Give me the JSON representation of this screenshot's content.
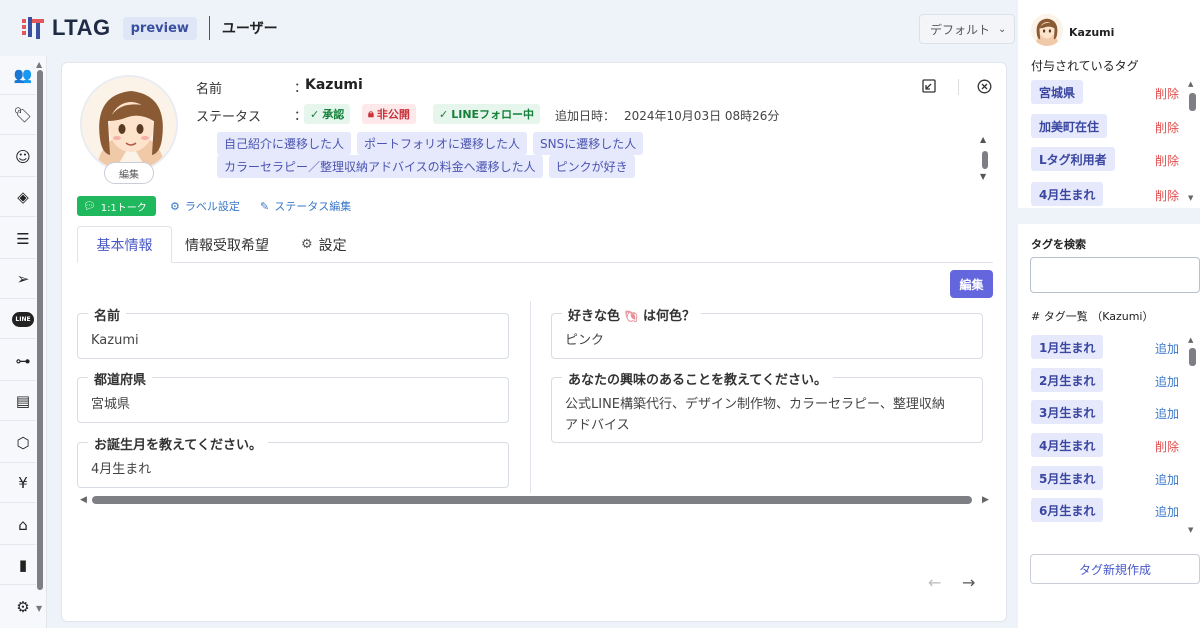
{
  "header": {
    "logo_text": "LTAG",
    "preview_badge": "preview",
    "page_title": "ユーザー",
    "view_select": "デフォルト"
  },
  "sidebar": {
    "items": [
      {
        "icon": "users-icon",
        "glyph": "👥"
      },
      {
        "icon": "tag-icon",
        "glyph": "🏷"
      },
      {
        "icon": "smile-icon",
        "glyph": "☺"
      },
      {
        "icon": "diamond-tag-icon",
        "glyph": "◈"
      },
      {
        "icon": "list-icon",
        "glyph": "☰"
      },
      {
        "icon": "send-icon",
        "glyph": "➢"
      },
      {
        "icon": "line-icon",
        "glyph": "LINE"
      },
      {
        "icon": "hierarchy-icon",
        "glyph": "⊶"
      },
      {
        "icon": "document-icon",
        "glyph": "▤"
      },
      {
        "icon": "box-icon",
        "glyph": "⬡"
      },
      {
        "icon": "yen-icon",
        "glyph": "¥"
      },
      {
        "icon": "shop-icon",
        "glyph": "⌂"
      },
      {
        "icon": "chart-icon",
        "glyph": "▮"
      },
      {
        "icon": "gear-icon",
        "glyph": "⚙"
      }
    ]
  },
  "profile": {
    "avatar_edit": "編集",
    "name_label": "名前",
    "name_value": "Kazumi",
    "status_label": "ステータス",
    "colon": "：",
    "statuses": [
      "承認",
      "非公開",
      "LINEフォロー中"
    ],
    "added_label": "追加日時：",
    "added_value": "2024年10月03日 08時26分",
    "labels_row1": [
      "自己紹介に遷移した人",
      "ポートフォリオに遷移した人",
      "SNSに遷移した人"
    ],
    "labels_row2": [
      "カラーセラピー／整理収納アドバイスの料金へ遷移した人",
      "ピンクが好き"
    ],
    "talk_button": "1:1トーク",
    "label_settings": "ラベル設定",
    "status_edit": "ステータス編集"
  },
  "tabs": {
    "basic": "基本情報",
    "preference": "情報受取希望",
    "settings": "設定"
  },
  "edit_button": "編集",
  "fields": {
    "name": {
      "label": "名前",
      "value": "Kazumi"
    },
    "prefecture": {
      "label": "都道府県",
      "value": "宮城県"
    },
    "birth_month": {
      "label": "お誕生月を教えてください。",
      "value": "4月生まれ"
    },
    "favorite_color": {
      "label_before": "好きな色",
      "label_after": "は何色？",
      "value": "ピンク"
    },
    "interests": {
      "label": "あなたの興味のあることを教えてください。",
      "value_line1": "公式LINE構築代行、デザイン制作物、カラーセラピー、整理収納",
      "value_line2": "アドバイス"
    }
  },
  "right_panel": {
    "user_name": "Kazumi",
    "assigned_title": "付与されているタグ",
    "assigned_tags": [
      {
        "name": "宮城県",
        "action": "削除"
      },
      {
        "name": "加美町在住",
        "action": "削除"
      },
      {
        "name": "Lタグ利用者",
        "action": "削除"
      },
      {
        "name": "4月生まれ",
        "action": "削除"
      }
    ],
    "search_title": "タグを検索",
    "list_title": "# タグ一覧 （Kazumi）",
    "tag_list": [
      {
        "name": "1月生まれ",
        "action": "追加",
        "type": "add"
      },
      {
        "name": "2月生まれ",
        "action": "追加",
        "type": "add"
      },
      {
        "name": "3月生まれ",
        "action": "追加",
        "type": "add"
      },
      {
        "name": "4月生まれ",
        "action": "削除",
        "type": "delete"
      },
      {
        "name": "5月生まれ",
        "action": "追加",
        "type": "add"
      },
      {
        "name": "6月生まれ",
        "action": "追加",
        "type": "add"
      }
    ],
    "create_button": "タグ新規作成"
  },
  "colors": {
    "accent": "#6466de",
    "line_green": "#1fb85c",
    "delete_red": "#e04d4d",
    "link_blue": "#3a78c8"
  }
}
